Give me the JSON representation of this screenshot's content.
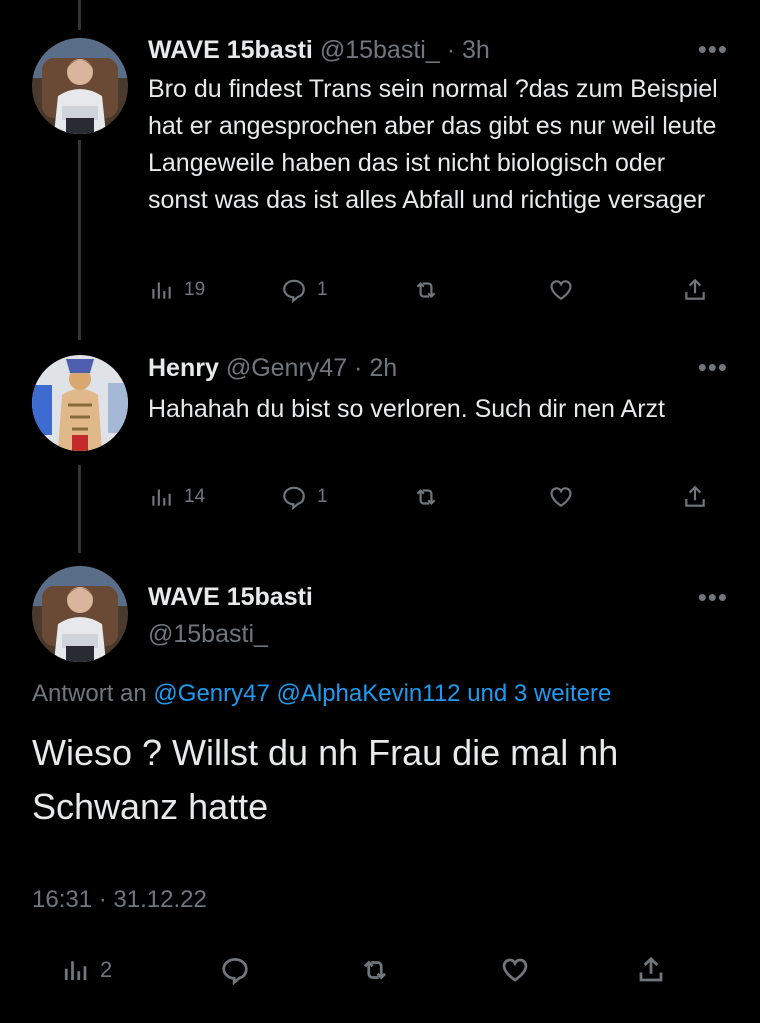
{
  "tweets": [
    {
      "name": "WAVE 15basti",
      "handle": "@15basti_",
      "time": "· 3h",
      "more": "•••",
      "text": "Bro du findest Trans sein normal ?das zum Beispiel hat er angesprochen aber das gibt es nur weil leute Langeweile haben das ist nicht biologisch oder sonst was das ist alles Abfall und richtige versager",
      "views": "19",
      "replies": "1"
    },
    {
      "name": "Henry",
      "handle": "@Genry47",
      "time": "· 2h",
      "more": "•••",
      "text": "Hahahah du bist so verloren. Such dir nen Arzt",
      "views": "14",
      "replies": "1"
    }
  ],
  "main_tweet": {
    "name": "WAVE 15basti",
    "handle": "@15basti_",
    "more": "•••",
    "reply_prefix": "Antwort an",
    "reply_to": "@Genry47 @AlphaKevin112 und 3 weitere",
    "text": "Wieso ? Willst du nh Frau die mal nh Schwanz hatte",
    "timestamp": "16:31 · 31.12.22",
    "views": "2"
  },
  "icons": [
    "views-icon",
    "reply-icon",
    "retweet-icon",
    "like-icon",
    "share-icon"
  ],
  "colors": {
    "background": "#000000",
    "text": "#e7e9ea",
    "muted": "#71767b",
    "link": "#1d9bf0"
  }
}
